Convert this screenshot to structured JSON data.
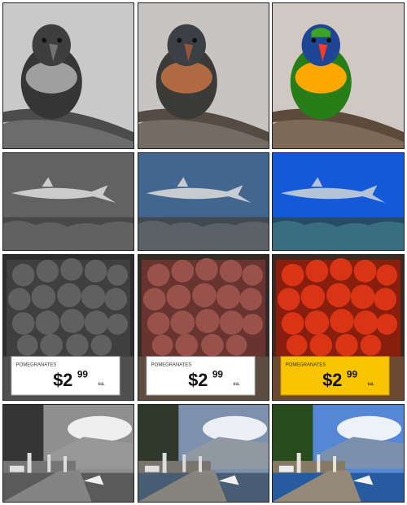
{
  "grid": {
    "columns": [
      "grayscale",
      "partial-color",
      "full-color"
    ],
    "rows": [
      "lorikeet",
      "shark",
      "pomegranates",
      "lakeside-promenade"
    ]
  },
  "pomegranates": {
    "sign_label": "POMEGRANATES",
    "price_dollar": "$2",
    "price_cents": "99",
    "unit": "ea.",
    "sign_colors": {
      "plain": "#ffffff",
      "colored": "#f2c418"
    }
  }
}
